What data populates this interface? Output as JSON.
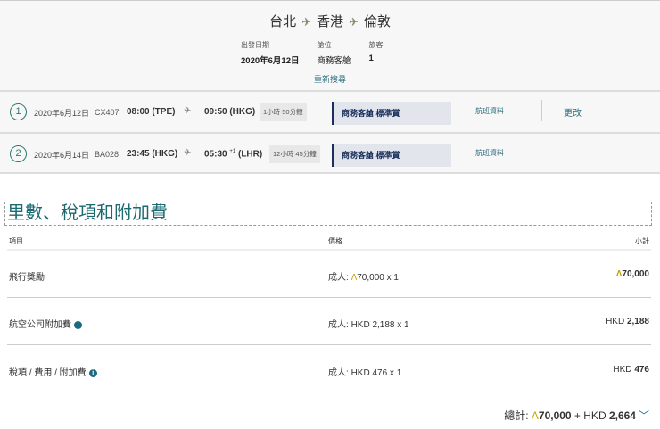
{
  "route": {
    "from": "台北",
    "via": "香港",
    "to": "倫敦"
  },
  "meta": [
    {
      "label": "出發日期",
      "value": "2020年6月12日"
    },
    {
      "label": "艙位",
      "value": "商務客艙"
    },
    {
      "label": "旅客",
      "value": "1"
    }
  ],
  "research": "重新搜尋",
  "flights": [
    {
      "num": "1",
      "date": "2020年6月12日",
      "flight": "CX407",
      "dep": "08:00 (TPE)",
      "arr": "09:50 (HKG)",
      "arr_plus": "",
      "duration": "1小時 50分鐘",
      "cabin": "商務客艙 標準賞",
      "info": "航班資料",
      "change": "更改"
    },
    {
      "num": "2",
      "date": "2020年6月14日",
      "flight": "BA028",
      "dep": "23:45 (HKG)",
      "arr": "05:30",
      "arr_plus": "+1",
      "arr_code": "(LHR)",
      "duration": "12小時 45分鐘",
      "cabin": "商務客艙 標準賞",
      "info": "航班資料"
    }
  ],
  "section_title": "里數、稅項和附加費",
  "table": {
    "headers": [
      "項目",
      "價格",
      "小計"
    ],
    "rows": [
      {
        "item": "飛行獎勵",
        "price_prefix": "成人: ",
        "price_sym": "Λ",
        "price": "70,000 x 1",
        "sub_cur": "Λ",
        "sub": "70,000"
      },
      {
        "item": "航空公司附加費",
        "price_prefix": "成人: ",
        "price_sym": "",
        "price": "HKD 2,188 x 1",
        "sub_cur": "HKD ",
        "sub": "2,188"
      },
      {
        "item": "稅項 / 費用 / 附加費",
        "price_prefix": "成人: ",
        "price_sym": "",
        "price": "HKD 476 x 1",
        "sub_cur": "HKD ",
        "sub": "476"
      }
    ]
  },
  "total": {
    "label": "總計:",
    "miles_sym": "Λ",
    "miles": "70,000",
    "plus": " + HKD ",
    "amount": "2,664"
  }
}
